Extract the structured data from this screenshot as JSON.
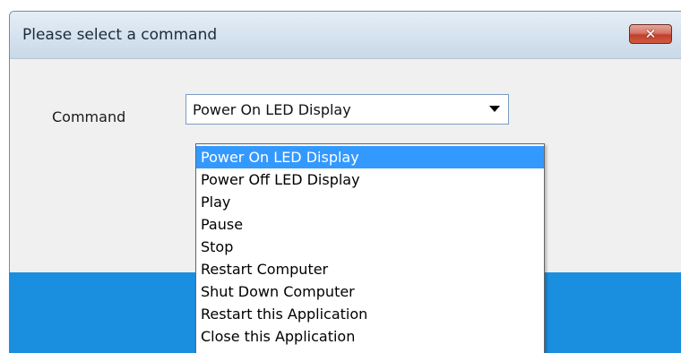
{
  "dialog": {
    "title": "Please select a command",
    "close_symbol": "✕"
  },
  "form": {
    "command_label": "Command",
    "command_selected": "Power On LED Display"
  },
  "dropdown": {
    "options": [
      "Power On LED Display",
      "Power Off LED Display",
      "Play",
      "Pause",
      "Stop",
      "Restart Computer",
      "Shut Down Computer",
      "Restart this Application",
      "Close this Application"
    ],
    "highlighted_index": 0
  },
  "colors": {
    "highlight": "#3399ff",
    "close_button": "#c1402d",
    "taskbar": "#1a8fe0"
  },
  "icons": {
    "close": "close-icon",
    "dropdown_arrow": "dropdown-arrow-icon"
  }
}
